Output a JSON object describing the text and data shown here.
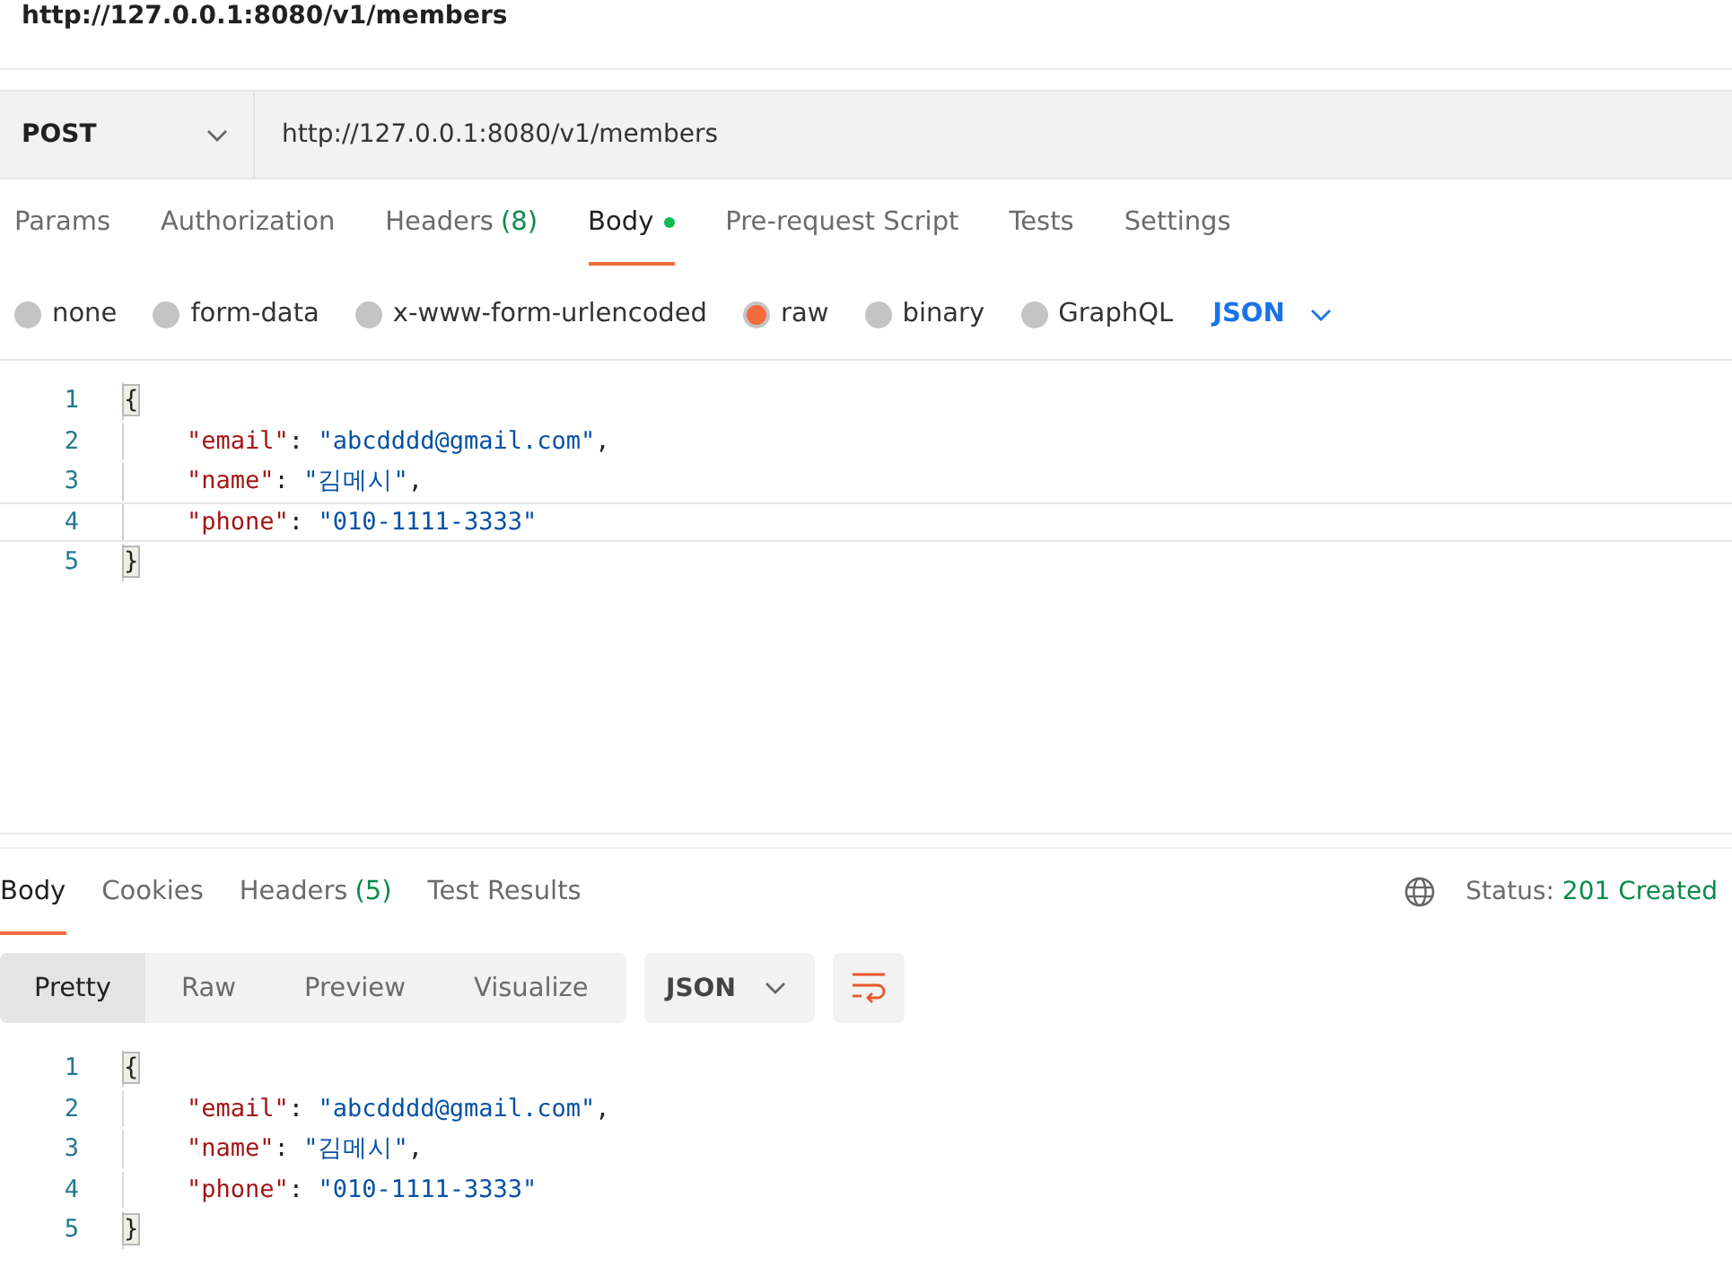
{
  "page_title": "http://127.0.0.1:8080/v1/members",
  "request": {
    "method": "POST",
    "url": "http://127.0.0.1:8080/v1/members"
  },
  "request_tabs": [
    {
      "label": "Params",
      "selected": false
    },
    {
      "label": "Authorization",
      "selected": false
    },
    {
      "label": "Headers",
      "count": "(8)",
      "selected": false
    },
    {
      "label": "Body",
      "indicator": true,
      "selected": true
    },
    {
      "label": "Pre-request Script",
      "selected": false
    },
    {
      "label": "Tests",
      "selected": false
    },
    {
      "label": "Settings",
      "selected": false
    }
  ],
  "body_types": [
    {
      "label": "none",
      "selected": false
    },
    {
      "label": "form-data",
      "selected": false
    },
    {
      "label": "x-www-form-urlencoded",
      "selected": false
    },
    {
      "label": "raw",
      "selected": true
    },
    {
      "label": "binary",
      "selected": false
    },
    {
      "label": "GraphQL",
      "selected": false
    }
  ],
  "body_format": "JSON",
  "request_editor": {
    "lines": [
      {
        "number": "1",
        "current": false,
        "tokens": [
          {
            "kind": "brace",
            "text": "{"
          }
        ]
      },
      {
        "number": "2",
        "current": false,
        "tokens": [
          {
            "kind": "key",
            "text": "\"email\""
          },
          {
            "kind": "punct",
            "text": ":"
          },
          {
            "kind": "string",
            "text": "\"abcdddd@gmail.com\""
          },
          {
            "kind": "punct",
            "text": ","
          }
        ]
      },
      {
        "number": "3",
        "current": false,
        "tokens": [
          {
            "kind": "key",
            "text": "\"name\""
          },
          {
            "kind": "punct",
            "text": ":"
          },
          {
            "kind": "string",
            "text": "\"김메시\""
          },
          {
            "kind": "punct",
            "text": ","
          }
        ]
      },
      {
        "number": "4",
        "current": true,
        "tokens": [
          {
            "kind": "key",
            "text": "\"phone\""
          },
          {
            "kind": "punct",
            "text": ":"
          },
          {
            "kind": "string",
            "text": "\"010-1111-3333\""
          }
        ]
      },
      {
        "number": "5",
        "current": false,
        "tokens": [
          {
            "kind": "brace",
            "text": "}"
          }
        ]
      }
    ]
  },
  "response_tabs": [
    {
      "label": "Body",
      "selected": true
    },
    {
      "label": "Cookies",
      "selected": false
    },
    {
      "label": "Headers",
      "count": "(5)",
      "selected": false
    },
    {
      "label": "Test Results",
      "selected": false
    }
  ],
  "status": {
    "label": "Status:",
    "value": "201 Created"
  },
  "view_modes": [
    {
      "label": "Pretty",
      "selected": true
    },
    {
      "label": "Raw",
      "selected": false
    },
    {
      "label": "Preview",
      "selected": false
    },
    {
      "label": "Visualize",
      "selected": false
    }
  ],
  "response_format": "JSON",
  "response_viewer": {
    "lines": [
      {
        "number": "1",
        "tokens": [
          {
            "kind": "brace",
            "text": "{"
          }
        ]
      },
      {
        "number": "2",
        "tokens": [
          {
            "kind": "key",
            "text": "\"email\""
          },
          {
            "kind": "punct",
            "text": ":"
          },
          {
            "kind": "string",
            "text": "\"abcdddd@gmail.com\""
          },
          {
            "kind": "punct",
            "text": ","
          }
        ]
      },
      {
        "number": "3",
        "tokens": [
          {
            "kind": "key",
            "text": "\"name\""
          },
          {
            "kind": "punct",
            "text": ":"
          },
          {
            "kind": "string",
            "text": "\"김메시\""
          },
          {
            "kind": "punct",
            "text": ","
          }
        ]
      },
      {
        "number": "4",
        "tokens": [
          {
            "kind": "key",
            "text": "\"phone\""
          },
          {
            "kind": "punct",
            "text": ":"
          },
          {
            "kind": "string",
            "text": "\"010-1111-3333\""
          }
        ]
      },
      {
        "number": "5",
        "tokens": [
          {
            "kind": "brace",
            "text": "}"
          }
        ]
      }
    ]
  }
}
